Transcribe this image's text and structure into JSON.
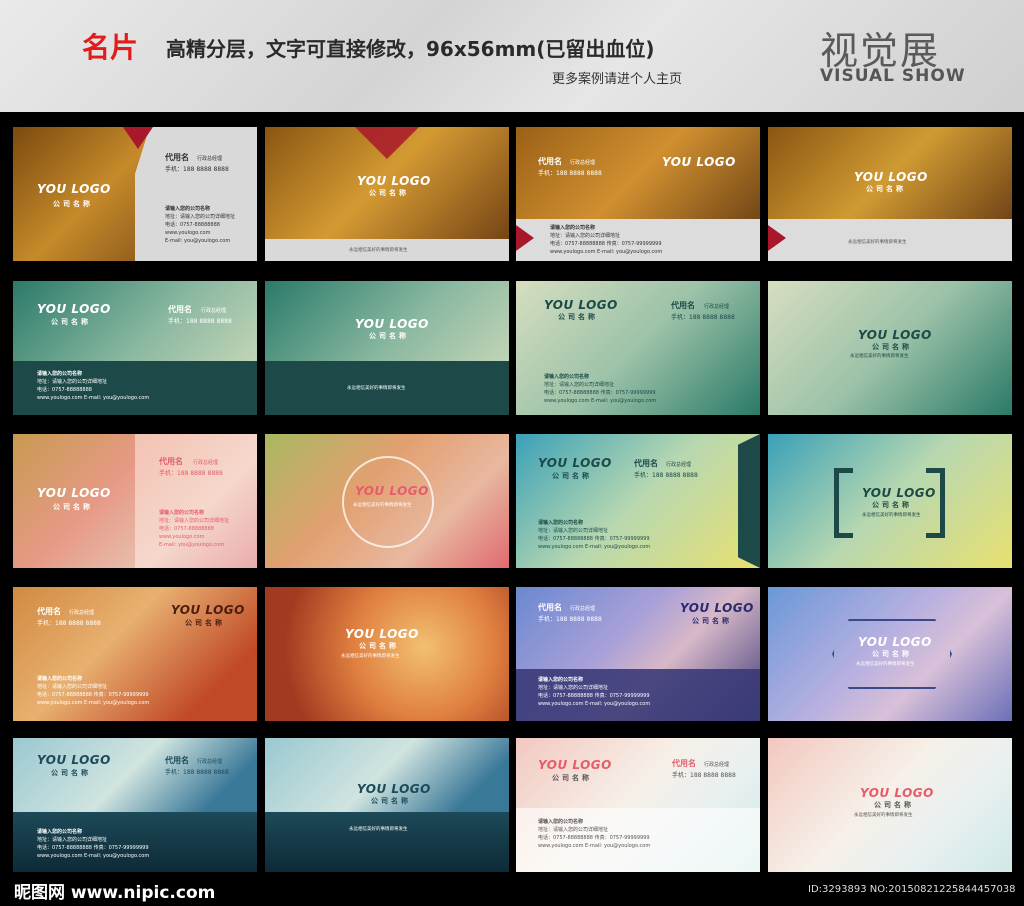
{
  "header": {
    "title": "名片",
    "subtitle": "高精分层，文字可直接修改，96x56mm(已留出血位)",
    "more": "更多案例请进个人主页",
    "brand_cn": "视觉展",
    "brand_en": "VISUAL SHOW"
  },
  "card_text": {
    "logo": "YOU LOGO",
    "company": "公司名称",
    "person": "代用名",
    "position": "行政总经理",
    "phone": "手机：188 8888 8888",
    "address_title": "请输入您的公司名称",
    "address": "地址：请输入您的公司详细地址",
    "tel": "电话：0757-88888888",
    "fax_line": "电话：0757-88888888  传真：0757-99999999",
    "web": "www.youlogo.com  E-mail: you@youlogo.com",
    "web_label": "www.youlogo.com",
    "email_line": "E-mail: you@youlogo.com",
    "slogan": "永远相信美好的事情即将发生"
  },
  "footer": {
    "site": "昵图网 www.nipic.com",
    "id": "ID:3293893 NO:20150821225844457038"
  },
  "colors": {
    "accent_red": "#e21b1b",
    "triangle_red": "#a8182a",
    "teal_dark": "#1d4a48",
    "pink_text": "#e55d6a"
  }
}
